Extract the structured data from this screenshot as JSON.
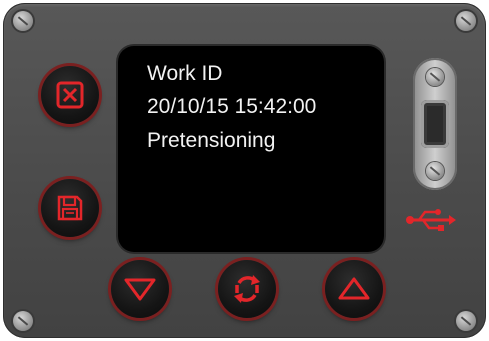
{
  "display": {
    "line1": "Work ID",
    "line2": "20/10/15 15:42:00",
    "line3": "Pretensioning"
  },
  "colors": {
    "panel": "#4e4e4e",
    "display_bg": "#000000",
    "display_text": "#f2f2f2",
    "button_accent": "#e3262a",
    "usb_symbol": "#e3262a"
  },
  "buttons": [
    {
      "icon": "cancel-icon"
    },
    {
      "icon": "save-icon"
    },
    {
      "icon": "down-arrow-icon"
    },
    {
      "icon": "refresh-icon"
    },
    {
      "icon": "up-arrow-icon"
    }
  ]
}
